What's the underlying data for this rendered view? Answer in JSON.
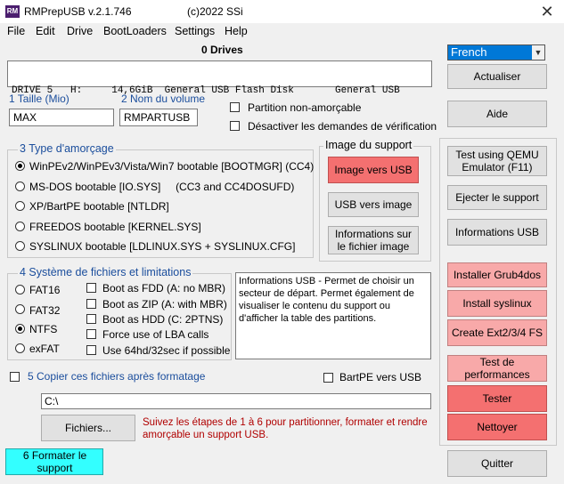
{
  "window": {
    "title": "RMPrepUSB v.2.1.746",
    "copyright": "(c)2022 SSi"
  },
  "menu": [
    "File",
    "Edit",
    "Drive",
    "BootLoaders",
    "Settings",
    "Help"
  ],
  "drives": {
    "count_label": "0 Drives",
    "row": "DRIVE 5   H:     14,6GiB  General USB Flash Disk       General USB"
  },
  "language": {
    "selected": "French"
  },
  "size": {
    "label": "1 Taille (Mio)",
    "value": "MAX"
  },
  "volume": {
    "label": "2 Nom du volume",
    "value": "RMPARTUSB"
  },
  "options": {
    "no_boot_partition": "Partition non-amorçable",
    "disable_prompts": "Désactiver les demandes de vérification"
  },
  "boot_type": {
    "legend": "3 Type d'amorçage",
    "items": [
      "WinPEv2/WinPEv3/Vista/Win7 bootable [BOOTMGR] (CC4)",
      "MS-DOS bootable [IO.SYS]     (CC3 and CC4DOSUFD)",
      "XP/BartPE bootable [NTLDR]",
      "FREEDOS bootable [KERNEL.SYS]",
      "SYSLINUX bootable [LDLINUX.SYS + SYSLINUX.CFG]"
    ]
  },
  "image": {
    "legend": "Image du support",
    "to_usb": "Image vers USB",
    "to_image": "USB vers image",
    "info": "Informations sur le fichier image"
  },
  "fs": {
    "legend": "4 Système de fichiers et limitations",
    "types": [
      "FAT16",
      "FAT32",
      "NTFS",
      "exFAT"
    ],
    "checks": [
      "Boot as FDD (A: no MBR)",
      "Boot as ZIP (A: with MBR)",
      "Boot as HDD (C: 2PTNS)",
      "Force use of LBA calls",
      "Use 64hd/32sec if possible"
    ]
  },
  "info_text": "Informations USB - Permet de choisir un secteur de départ. Permet également de visualiser le contenu du support ou d'afficher la table des partitions.",
  "copy": {
    "label": "5 Copier ces fichiers après formatage",
    "bartpe": "BartPE vers USB",
    "path": "C:\\",
    "files_button": "Fichiers..."
  },
  "hint": "Suivez les étapes de 1 à 6 pour partitionner, formater et rendre amorçable un support USB.",
  "format_button": "6 Formater le support",
  "right": {
    "refresh": "Actualiser",
    "help": "Aide",
    "qemu": "Test using QEMU Emulator (F11)",
    "eject": "Ejecter le support",
    "usb_info": "Informations USB",
    "grub4dos": "Installer Grub4dos",
    "syslinux": "Install syslinux",
    "ext": "Create Ext2/3/4 FS",
    "perf": "Test de performances",
    "test": "Tester",
    "clean": "Nettoyer",
    "quit": "Quitter"
  }
}
